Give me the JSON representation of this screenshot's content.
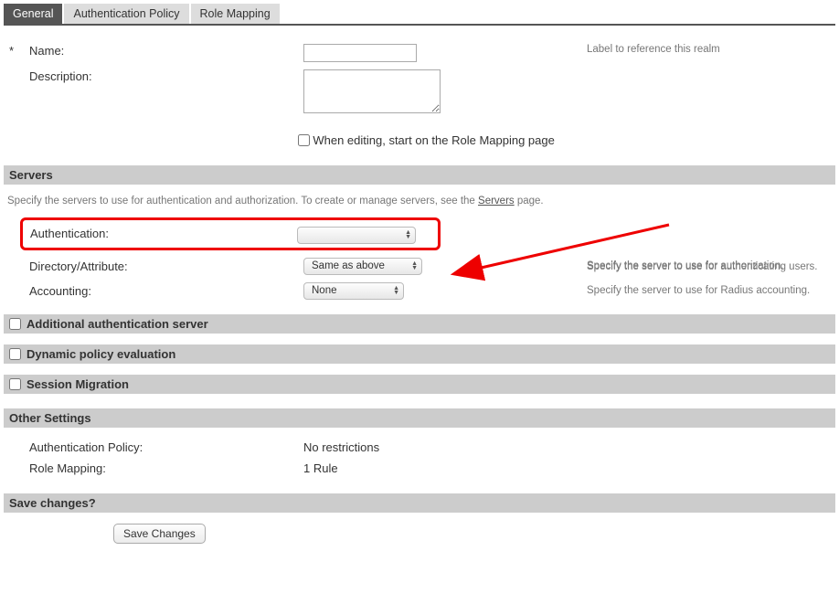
{
  "tabs": {
    "general": "General",
    "auth_policy": "Authentication Policy",
    "role_mapping": "Role Mapping"
  },
  "fields": {
    "name_label": "Name:",
    "name_help": "Label to reference this realm",
    "desc_label": "Description:",
    "editing_checkbox": "When editing, start on the Role Mapping page"
  },
  "servers_section": {
    "header": "Servers",
    "note_pre": "Specify the servers to use for authentication and authorization. To create or manage servers, see the ",
    "note_link": "Servers",
    "note_post": " page.",
    "auth_label": "Authentication:",
    "auth_value": "",
    "auth_help": "Specify the server to use for authenticating users.",
    "dir_label": "Directory/Attribute:",
    "dir_value": "Same as above",
    "dir_help": "Specify the server to use for authorization.",
    "acct_label": "Accounting:",
    "acct_value": "None",
    "acct_help": "Specify the server to use for Radius accounting."
  },
  "toggle_sections": {
    "additional_auth": "Additional authentication server",
    "dynamic_policy": "Dynamic policy evaluation",
    "session_migration": "Session Migration"
  },
  "other_settings": {
    "header": "Other Settings",
    "auth_policy_label": "Authentication Policy:",
    "auth_policy_value": "No restrictions",
    "role_mapping_label": "Role Mapping:",
    "role_mapping_value": "1 Rule"
  },
  "save": {
    "header": "Save changes?",
    "button": "Save Changes"
  }
}
